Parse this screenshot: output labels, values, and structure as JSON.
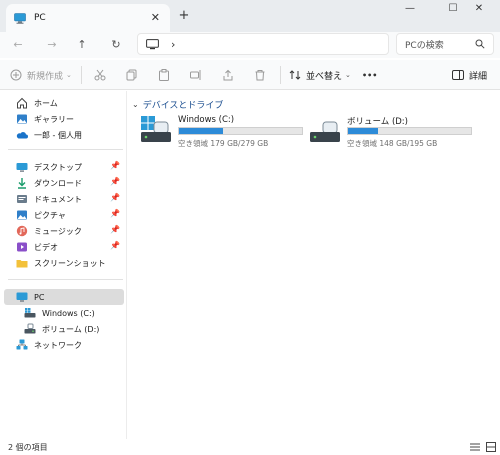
{
  "window": {
    "tab_title": "PC",
    "close_tab": "✕",
    "new_tab": "+",
    "minimize": "—",
    "maximize": "☐",
    "close": "✕"
  },
  "nav": {
    "back": "←",
    "forward": "→",
    "up": "↑",
    "refresh": "↻",
    "breadcrumb_sep": "›",
    "search_placeholder": "PCの検索"
  },
  "toolbar": {
    "new_label": "新規作成",
    "sort_label": "並べ替え",
    "more": "•••",
    "details_label": "詳細"
  },
  "sidebar": {
    "items": [
      {
        "label": "ホーム",
        "icon": "home-icon"
      },
      {
        "label": "ギャラリー",
        "icon": "gallery-icon"
      },
      {
        "label": "一郎 - 個人用",
        "icon": "onedrive-icon"
      },
      {
        "label": "デスクトップ",
        "icon": "desktop-icon",
        "pinned": true
      },
      {
        "label": "ダウンロード",
        "icon": "download-icon",
        "pinned": true
      },
      {
        "label": "ドキュメント",
        "icon": "documents-icon",
        "pinned": true
      },
      {
        "label": "ピクチャ",
        "icon": "pictures-icon",
        "pinned": true
      },
      {
        "label": "ミュージック",
        "icon": "music-icon",
        "pinned": true
      },
      {
        "label": "ビデオ",
        "icon": "videos-icon",
        "pinned": true
      },
      {
        "label": "スクリーンショット",
        "icon": "folder-icon",
        "pinned": false
      },
      {
        "label": "PC",
        "icon": "pc-icon",
        "selected": true
      },
      {
        "label": "Windows (C:)",
        "icon": "drive-c-icon"
      },
      {
        "label": "ボリューム (D:)",
        "icon": "drive-d-icon"
      },
      {
        "label": "ネットワーク",
        "icon": "network-icon"
      }
    ]
  },
  "content": {
    "group_title": "デバイスとドライブ",
    "drives": [
      {
        "name": "Windows (C:)",
        "free_text": "空き領域 179 GB/279 GB",
        "used_fraction": 0.36
      },
      {
        "name": "ボリューム (D:)",
        "free_text": "空き領域 148 GB/195 GB",
        "used_fraction": 0.24
      }
    ]
  },
  "status": {
    "item_count": "2 個の項目"
  },
  "colors": {
    "accent": "#2d8bd8",
    "selected_bg": "#dcdcdc",
    "titlebar_bg": "#e9ecef"
  }
}
